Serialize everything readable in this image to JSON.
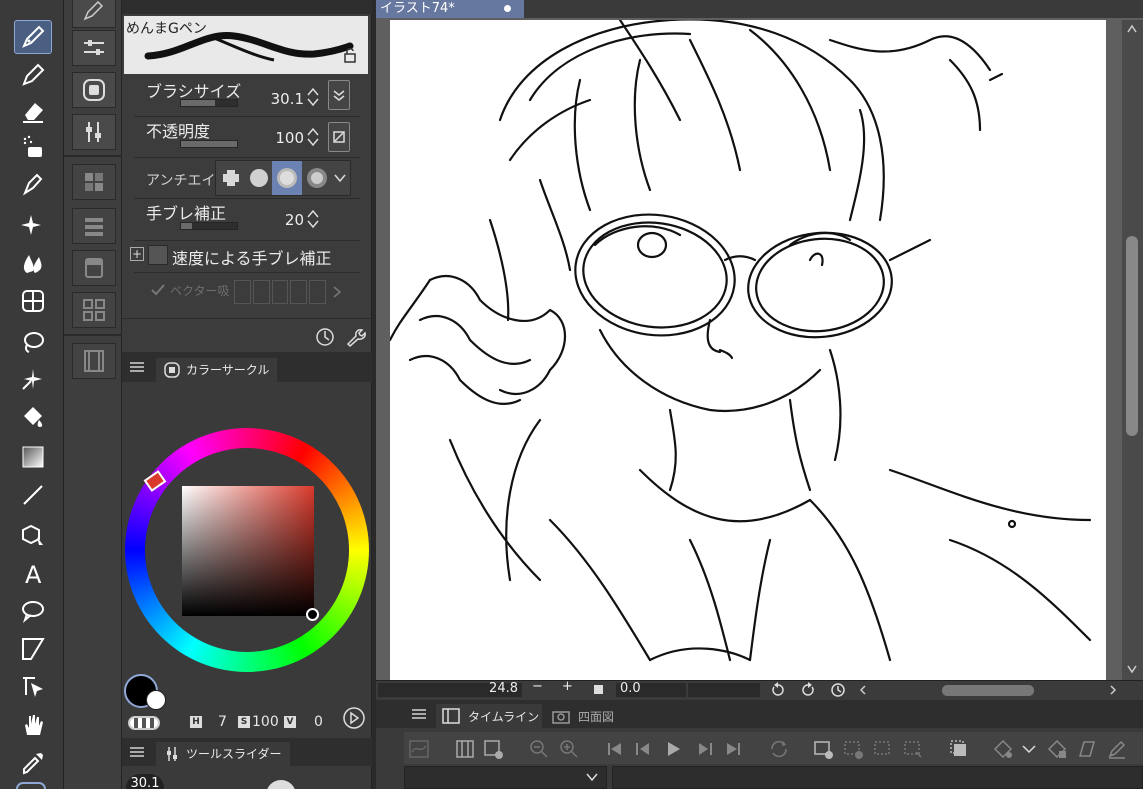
{
  "tool_property": {
    "brush_name": "めんまGペン",
    "brush_size_label": "ブラシサイズ",
    "brush_size_value": "30.1",
    "opacity_label": "不透明度",
    "opacity_value": "100",
    "antialias_label": "アンチエイリ",
    "stabilization_label": "手ブレ補正",
    "stabilization_value": "20",
    "speed_stabilization_label": "速度による手ブレ補正",
    "vector_label": "ベクター吸"
  },
  "color_panel": {
    "tab_label": "カラーサークル",
    "h_label": "H",
    "h_value": "7",
    "s_label": "S",
    "s_value": "100",
    "v_label": "V",
    "v_value": "0",
    "main_color": "#000000",
    "selected_hue_color": "#d93a2c"
  },
  "tool_slider": {
    "tab_label": "ツールスライダー",
    "value": "30.1"
  },
  "canvas": {
    "document_tab": "イラスト74*",
    "zoom": "24.8",
    "rotation": "0.0"
  },
  "timeline": {
    "tab_timeline": "タイムライン",
    "tab_fourview": "四面図"
  },
  "colors": {
    "accent": "#6677a0",
    "panel_bg": "#3c3c3c"
  }
}
